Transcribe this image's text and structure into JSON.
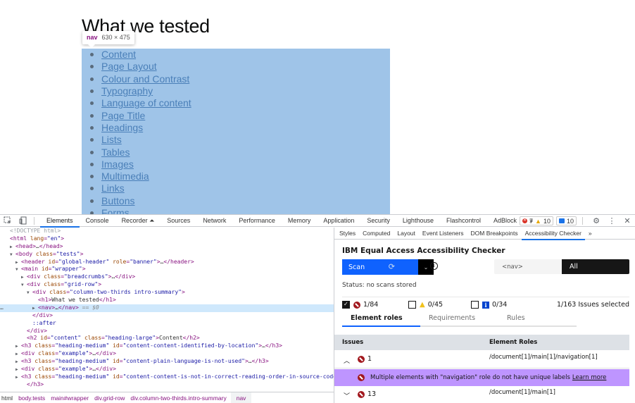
{
  "page": {
    "heading": "What we tested",
    "nav_items": [
      "Content",
      "Page Layout",
      "Colour and Contrast",
      "Typography",
      "Language of content",
      "Page Title",
      "Headings",
      "Lists",
      "Tables",
      "Images",
      "Multimedia",
      "Links",
      "Buttons",
      "Forms"
    ],
    "highlight_color": "#9fc4e8",
    "tooltip": {
      "tag": "nav",
      "size": "630 × 475"
    }
  },
  "devtools": {
    "toolbar": {
      "inspect_icon": "inspect-element-icon",
      "device_icon": "device-toggle-icon",
      "tabs": [
        "Elements",
        "Console",
        "Recorder ⏶",
        "Sources",
        "Network",
        "Performance",
        "Memory",
        "Application",
        "Security",
        "Lighthouse",
        "Flashcontrol",
        "AdBlock",
        "»"
      ],
      "active_tab": "Elements",
      "errors": "7",
      "warnings": "10",
      "messages": "10",
      "settings_icon": "⚙",
      "more_icon": "⋮",
      "close_icon": "✕"
    },
    "dom": [
      {
        "indent": 0,
        "tri": "",
        "html": "doctype",
        "text": "<!DOCTYPE html>"
      },
      {
        "indent": 0,
        "tri": "",
        "tag": "html",
        "attrs": [
          [
            "lang",
            "en"
          ]
        ],
        "tail": ""
      },
      {
        "indent": 1,
        "tri": "▶",
        "tag": "head",
        "collapsed": true
      },
      {
        "indent": 1,
        "tri": "▼",
        "tag": "body",
        "attrs": [
          [
            "class",
            "tests"
          ]
        ]
      },
      {
        "indent": 2,
        "tri": "▶",
        "tag": "header",
        "attrs": [
          [
            "id",
            "global-header"
          ],
          [
            "role",
            "banner"
          ]
        ],
        "collapsed": true
      },
      {
        "indent": 2,
        "tri": "▼",
        "tag": "main",
        "attrs": [
          [
            "id",
            "wrapper"
          ]
        ]
      },
      {
        "indent": 3,
        "tri": "▶",
        "tag": "div",
        "attrs": [
          [
            "class",
            "breadcrumbs"
          ]
        ],
        "collapsed": true
      },
      {
        "indent": 3,
        "tri": "▼",
        "tag": "div",
        "attrs": [
          [
            "class",
            "grid-row"
          ]
        ]
      },
      {
        "indent": 4,
        "tri": "▼",
        "tag": "div",
        "attrs": [
          [
            "class",
            "column-two-thirds intro-summary"
          ]
        ]
      },
      {
        "indent": 5,
        "tri": "",
        "tag": "h1",
        "inner": "What we tested"
      },
      {
        "indent": 5,
        "tri": "▶",
        "tag": "nav",
        "collapsed": true,
        "selected": true,
        "suffix": "== $0"
      },
      {
        "indent": 4,
        "tri": "",
        "close": "div"
      },
      {
        "indent": 4,
        "tri": "",
        "pseudo": "::after"
      },
      {
        "indent": 3,
        "tri": "",
        "close": "div"
      },
      {
        "indent": 3,
        "tri": "",
        "tag": "h2",
        "attrs": [
          [
            "id",
            "content"
          ],
          [
            "class",
            "heading-large"
          ]
        ],
        "inner": "Content"
      },
      {
        "indent": 2,
        "tri": "▶",
        "tag": "h3",
        "attrs": [
          [
            "class",
            "heading-medium"
          ],
          [
            "id",
            "content-content-identified-by-location"
          ]
        ],
        "collapsed": true
      },
      {
        "indent": 2,
        "tri": "▶",
        "tag": "div",
        "attrs": [
          [
            "class",
            "example"
          ]
        ],
        "collapsed": true
      },
      {
        "indent": 2,
        "tri": "▶",
        "tag": "h3",
        "attrs": [
          [
            "class",
            "heading-medium"
          ],
          [
            "id",
            "content-plain-language-is-not-used"
          ]
        ],
        "collapsed": true
      },
      {
        "indent": 2,
        "tri": "▶",
        "tag": "div",
        "attrs": [
          [
            "class",
            "example"
          ]
        ],
        "collapsed": true
      },
      {
        "indent": 2,
        "tri": "▶",
        "tag": "h3",
        "attrs": [
          [
            "class",
            "heading-medium"
          ],
          [
            "id",
            "content-content-is-not-in-correct-reading-order-in-source-code"
          ]
        ],
        "open_ellipsis": true
      },
      {
        "indent": 3,
        "tri": "",
        "close": "h3"
      }
    ],
    "breadcrumbs": [
      "html",
      "body.tests",
      "main#wrapper",
      "div.grid-row",
      "div.column-two-thirds.intro-summary",
      "nav"
    ],
    "sidebar_tabs": [
      "Styles",
      "Computed",
      "Layout",
      "Event Listeners",
      "DOM Breakpoints",
      "Accessibility Checker",
      "»"
    ],
    "sidebar_active": "Accessibility Checker"
  },
  "checker": {
    "title": "IBM Equal Access Accessibility Checker",
    "scan_label": "Scan",
    "focus_selected": "<nav>",
    "focus_all": "All",
    "status": "Status: no scans stored",
    "filters": [
      {
        "type": "violation",
        "checked": true,
        "count": "1/84"
      },
      {
        "type": "needs-review",
        "checked": false,
        "count": "0/45"
      },
      {
        "type": "recommendation",
        "checked": false,
        "count": "0/34"
      }
    ],
    "selected_count": "1/163 Issues selected",
    "view_tabs": [
      "Element roles",
      "Requirements",
      "Rules"
    ],
    "active_view": "Element roles",
    "table_headers": {
      "issues": "Issues",
      "roles": "Element Roles"
    },
    "rows": [
      {
        "expanded": true,
        "count": "1",
        "path": "/document[1]/main[1]/navigation[1]"
      },
      {
        "expanded": false,
        "count": "13",
        "path": "/document[1]/main[1]"
      }
    ],
    "detail": {
      "message": "Multiple elements with \"navigation\" role do not have unique labels",
      "link": "Learn more",
      "bg": "#be95ff"
    },
    "colors": {
      "primary": "#0f62fe",
      "violation": "#a2191f",
      "header_bg": "#dde1e6"
    }
  }
}
